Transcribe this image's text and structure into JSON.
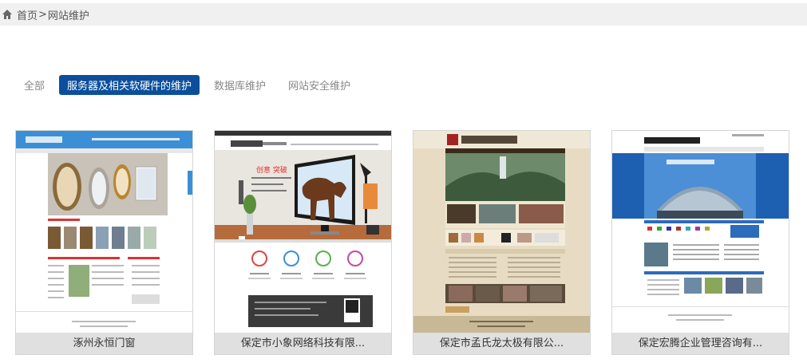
{
  "breadcrumb": {
    "home_icon": "home-icon",
    "home_label": "首页",
    "separator": ">",
    "current_label": "网站维护"
  },
  "tabs": [
    {
      "label": "全部",
      "active": false
    },
    {
      "label": "服务器及相关软硬件的维护",
      "active": true
    },
    {
      "label": "数据库维护",
      "active": false
    },
    {
      "label": "网站安全维护",
      "active": false
    }
  ],
  "colors": {
    "active_tab": "#0b4f9c",
    "breadcrumb_bg": "#f0f0f0",
    "caption_bg": "#e0e0e0"
  },
  "cards": [
    {
      "title": "涿州永恒门窗",
      "preview": "door-window-site"
    },
    {
      "title": "保定市小象网络科技有限...",
      "preview": "horse-monitor-site"
    },
    {
      "title": "保定市孟氏龙太极有限公...",
      "preview": "taiji-landscape-site"
    },
    {
      "title": "保定宏腾企业管理咨询有...",
      "preview": "dome-building-site"
    }
  ]
}
